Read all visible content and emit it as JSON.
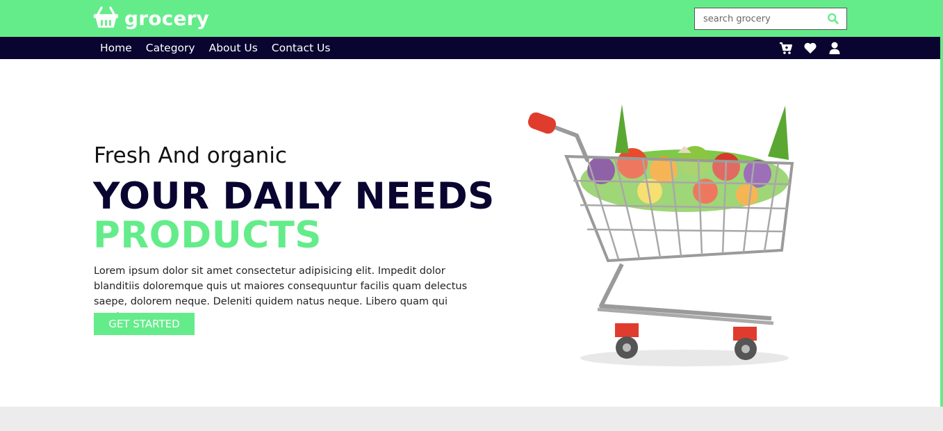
{
  "brand": {
    "name": "grocery",
    "icon": "basket-icon"
  },
  "search": {
    "placeholder": "search grocery",
    "value": "",
    "icon": "search-icon"
  },
  "nav": {
    "links": [
      "Home",
      "Category",
      "About Us",
      "Contact Us"
    ],
    "icons": [
      "cart-icon",
      "heart-icon",
      "user-icon"
    ]
  },
  "hero": {
    "subtitle": "Fresh And organic",
    "headline": "YOUR DAILY NEEDS",
    "headline_accent": "PRODUCTS",
    "description": "Lorem ipsum dolor sit amet consectetur adipisicing elit. Impedit dolor blanditiis doloremque quis ut maiores consequuntur facilis quam delectus saepe, dolorem neque. Deleniti quidem natus neque. Libero quam qui sunt!",
    "cta_label": "GET STARTED",
    "image": "shopping-cart-with-vegetables"
  },
  "colors": {
    "accent": "#64ec8a",
    "nav_bg": "#090430",
    "headline": "#090430"
  }
}
